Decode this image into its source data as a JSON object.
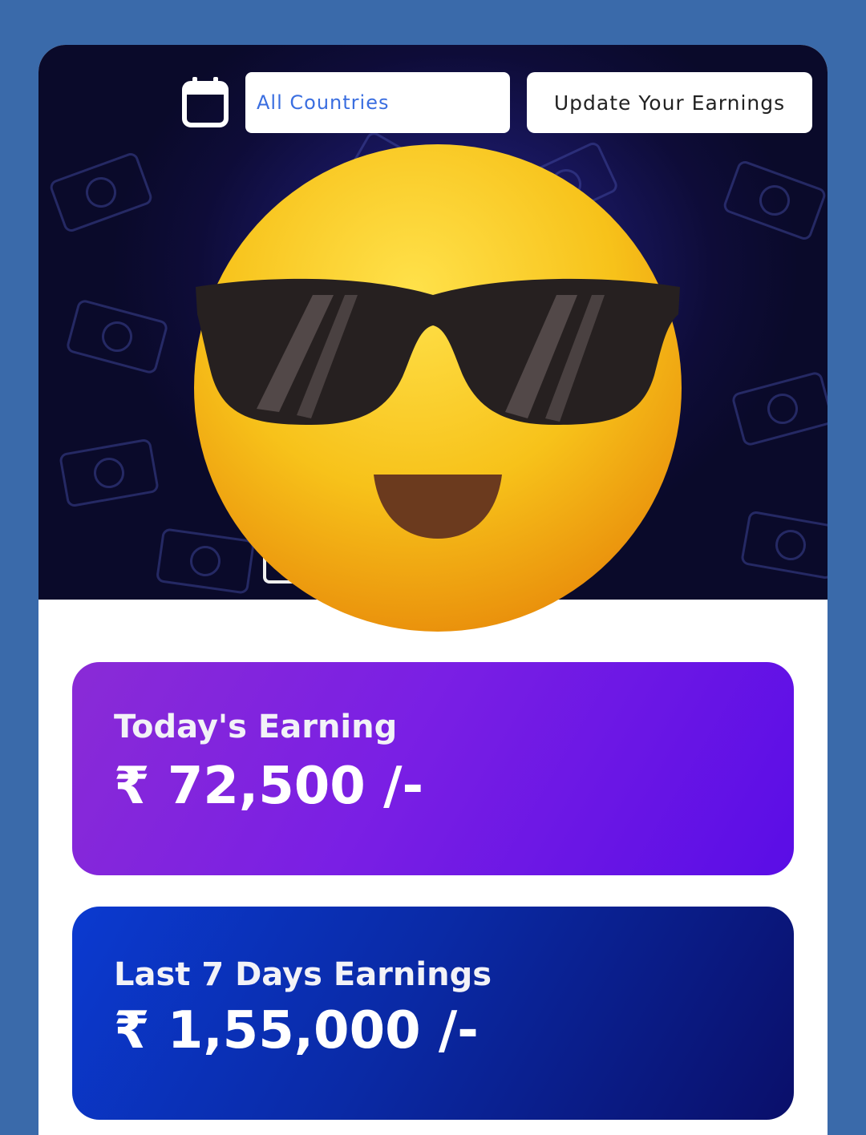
{
  "filters": {
    "calendar_icon": "calendar-icon",
    "country_value": "All Countries",
    "update_button_label": "Update Your Earnings"
  },
  "overlay": {
    "emoji_icon": "sunglasses-face-emoji"
  },
  "cards": {
    "today": {
      "label": "Today's Earning",
      "value": "₹ 72,500 /-"
    },
    "last7": {
      "label": "Last 7 Days Earnings",
      "value": "₹ 1,55,000 /-"
    }
  },
  "colors": {
    "page_bg": "#3a6aaa",
    "header_bg": "#141248",
    "today_card": "#7a1fe4",
    "week_card": "#0a2aa6",
    "emoji_yellow": "#f7c21a"
  }
}
